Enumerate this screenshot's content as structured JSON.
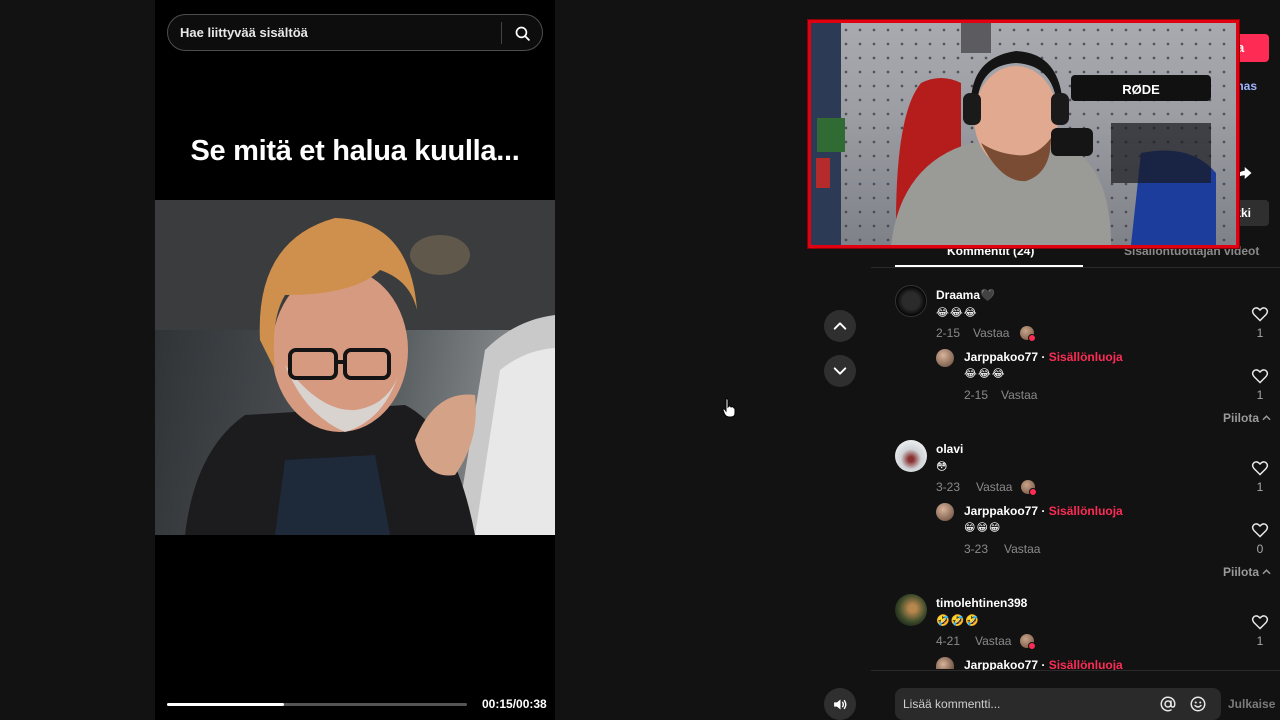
{
  "search": {
    "placeholder": "Hae liittyvää sisältöä"
  },
  "video": {
    "caption": "Se mitä et halua kuulla...",
    "time": "00:15/00:38",
    "progress": 0.39
  },
  "header_partial": {
    "follow_label": "a",
    "text_line1": "mas",
    "text_line2": "k",
    "link_label": "ikki"
  },
  "tabs": {
    "comments": "Kommentit (24)",
    "creator_videos": "Sisällöntuottajan videot"
  },
  "comments": [
    {
      "user": "Draama🖤",
      "text": "😂😂😂",
      "date": "2-15",
      "reply": "Vastaa",
      "likes": "1",
      "replies": [
        {
          "user": "Jarppakoo77",
          "badge": "Sisällönluoja",
          "text": "😂😂😂",
          "date": "2-15",
          "reply": "Vastaa",
          "likes": "1"
        }
      ],
      "hide": "Piilota"
    },
    {
      "user": "olavi",
      "text": "😳",
      "date": "3-23",
      "reply": "Vastaa",
      "likes": "1",
      "replies": [
        {
          "user": "Jarppakoo77",
          "badge": "Sisällönluoja",
          "text": "😁😁😁",
          "date": "3-23",
          "reply": "Vastaa",
          "likes": "0"
        }
      ],
      "hide": "Piilota"
    },
    {
      "user": "timolehtinen398",
      "text": "🤣🤣🤣",
      "date": "4-21",
      "reply": "Vastaa",
      "likes": "1",
      "replies": [
        {
          "user": "Jarppakoo77",
          "badge": "Sisällönluoja"
        }
      ]
    }
  ],
  "comment_input": {
    "placeholder": "Lisää kommentti...",
    "publish": "Julkaise"
  },
  "webcam": {
    "mic_brand": "RØDE"
  },
  "colors": {
    "accent": "#fe2c55",
    "webcam_border": "#e10010",
    "background": "#121212"
  },
  "icons": [
    "search-icon",
    "chevron-up-icon",
    "chevron-down-icon",
    "volume-icon",
    "heart-icon",
    "chevron-up-small-icon",
    "at-icon",
    "emoji-icon",
    "share-icon",
    "pointer-cursor-icon"
  ]
}
